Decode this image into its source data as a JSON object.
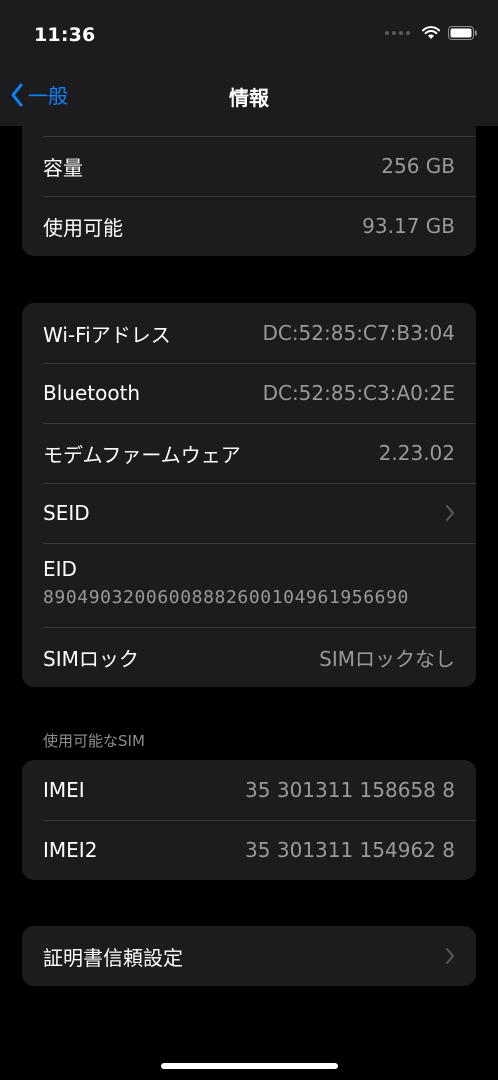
{
  "status_bar": {
    "time": "11:36"
  },
  "nav": {
    "back_label": "一般",
    "title": "情報"
  },
  "storage": {
    "rows": [
      {
        "label": "容量",
        "value": "256 GB"
      },
      {
        "label": "使用可能",
        "value": "93.17 GB"
      }
    ]
  },
  "network": {
    "wifi": {
      "label": "Wi-Fiアドレス",
      "value": "DC:52:85:C7:B3:04"
    },
    "bluetooth": {
      "label": "Bluetooth",
      "value": "DC:52:85:C3:A0:2E"
    },
    "modem": {
      "label": "モデムファームウェア",
      "value": "2.23.02"
    },
    "seid": {
      "label": "SEID"
    },
    "eid": {
      "label": "EID",
      "value": "89049032006008882600104961956690"
    },
    "sim_lock": {
      "label": "SIMロック",
      "value": "SIMロックなし"
    }
  },
  "sim_section": {
    "caption": "使用可能なSIM",
    "rows": [
      {
        "label": "IMEI",
        "value": "35 301311 158658 8"
      },
      {
        "label": "IMEI2",
        "value": "35 301311 154962 8"
      }
    ]
  },
  "certificate": {
    "label": "証明書信頼設定"
  },
  "colors": {
    "accent": "#0a84ff",
    "background": "#000000",
    "group_background": "#1c1c1e",
    "secondary_text": "#98989d"
  }
}
